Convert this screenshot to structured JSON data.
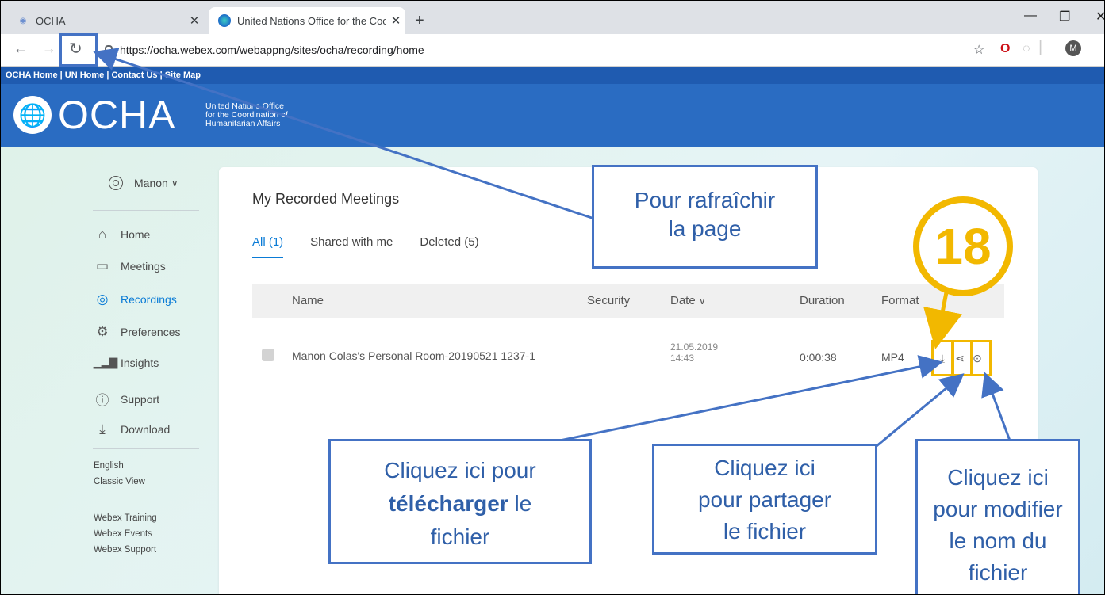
{
  "browser": {
    "tabs": [
      {
        "title": "OCHA",
        "active": false
      },
      {
        "title": "United Nations Office for the Coo",
        "active": true
      }
    ],
    "url": "https://ocha.webex.com/webappng/sites/ocha/recording/home",
    "profile_initial": "M"
  },
  "site": {
    "top_links": "OCHA Home | UN Home | Contact Us | Site Map",
    "logo": "OCHA",
    "logo_sub": [
      "United Nations Office",
      "for the Coordination of",
      "Humanitarian Affairs"
    ]
  },
  "sidebar": {
    "user": "Manon",
    "items": [
      {
        "label": "Home",
        "icon": "home-icon"
      },
      {
        "label": "Meetings",
        "icon": "meetings-icon"
      },
      {
        "label": "Recordings",
        "icon": "recordings-icon"
      },
      {
        "label": "Preferences",
        "icon": "gear-icon"
      },
      {
        "label": "Insights",
        "icon": "insights-icon"
      },
      {
        "label": "Support",
        "icon": "help-icon"
      },
      {
        "label": "Download",
        "icon": "download-icon"
      }
    ],
    "links1": [
      "English",
      "Classic View"
    ],
    "links2": [
      "Webex Training",
      "Webex Events",
      "Webex Support"
    ]
  },
  "main": {
    "title": "My Recorded Meetings",
    "tabs": [
      "All (1)",
      "Shared with me",
      "Deleted (5)"
    ],
    "columns": {
      "name": "Name",
      "security": "Security",
      "date": "Date",
      "duration": "Duration",
      "format": "Format"
    },
    "rows": [
      {
        "name": "Manon Colas's Personal Room-20190521 1237-1",
        "date": "21.05.2019",
        "time": "14:43",
        "duration": "0:00:38",
        "format": "MP4"
      }
    ]
  },
  "annotations": {
    "refresh": [
      "Pour rafraîchir",
      "la page"
    ],
    "download": {
      "line1": "Cliquez ici pour",
      "bold": "télécharger",
      "after": " le",
      "line3": "fichier"
    },
    "share": [
      "Cliquez ici",
      "pour partager",
      "le fichier"
    ],
    "rename": [
      "Cliquez ici",
      "pour modifier",
      "le nom du",
      "fichier"
    ],
    "step": "18"
  }
}
